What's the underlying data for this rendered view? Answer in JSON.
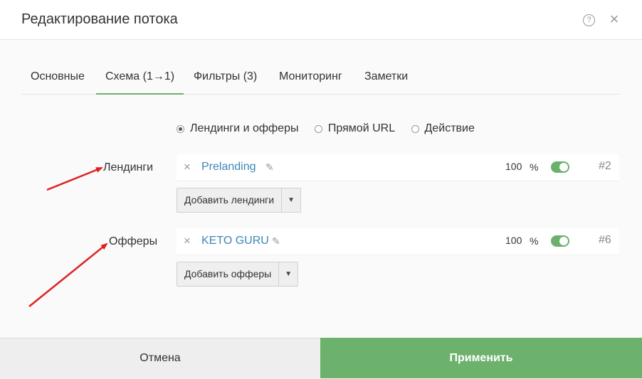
{
  "dialog": {
    "title": "Редактирование потока",
    "help_icon": "?",
    "close_icon": "×"
  },
  "tabs": [
    {
      "label": "Основные"
    },
    {
      "label": "Схема (1→1)",
      "active": true
    },
    {
      "label": "Фильтры (3)"
    },
    {
      "label": "Мониторинг"
    },
    {
      "label": "Заметки"
    }
  ],
  "scheme_options": {
    "selected": "Лендинги и офферы",
    "options": [
      {
        "label": "Лендинги и офферы"
      },
      {
        "label": "Прямой URL"
      },
      {
        "label": "Действие"
      }
    ]
  },
  "landings": {
    "label": "Лендинги",
    "items": [
      {
        "name": "Prelanding",
        "weight": "100",
        "percent_sign": "%",
        "enabled": true,
        "id": "#2"
      }
    ],
    "add_label": "Добавить лендинги"
  },
  "offers": {
    "label": "Офферы",
    "items": [
      {
        "name": "KETO GURU",
        "weight": "100",
        "percent_sign": "%",
        "enabled": true,
        "id": "#6"
      }
    ],
    "add_label": "Добавить офферы"
  },
  "footer": {
    "cancel_label": "Отмена",
    "apply_label": "Применить"
  },
  "icons": {
    "remove": "×",
    "edit": "✎",
    "caret": "▼"
  },
  "colors": {
    "accent_green": "#6db26c",
    "link_blue": "#3d86b8",
    "annotation_red": "#e02020"
  }
}
